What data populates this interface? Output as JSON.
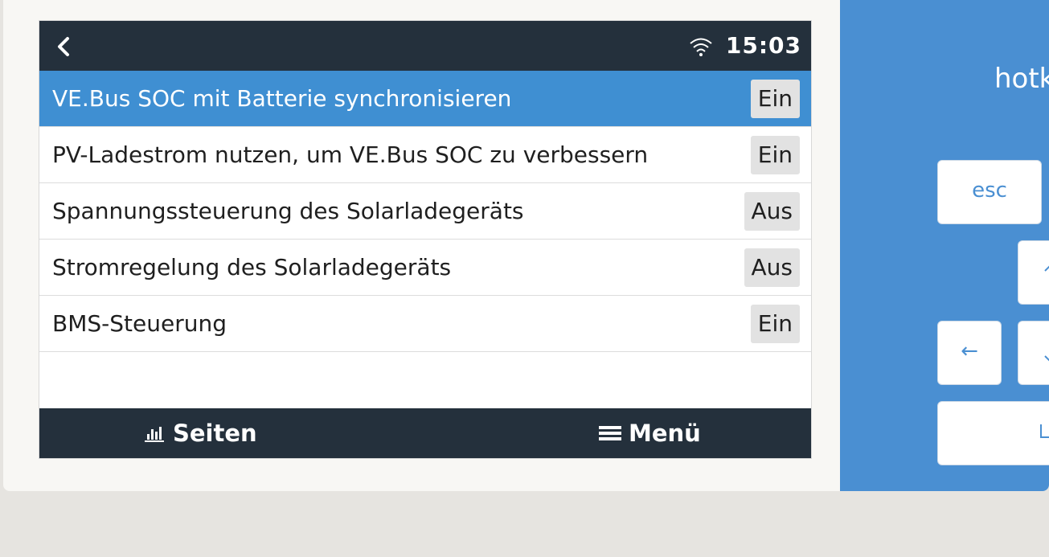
{
  "status": {
    "time": "15:03"
  },
  "settings": [
    {
      "label": "VE.Bus SOC mit Batterie synchronisieren",
      "value": "Ein",
      "selected": true
    },
    {
      "label": "PV-Ladestrom nutzen, um VE.Bus SOC zu verbessern",
      "value": "Ein",
      "selected": false
    },
    {
      "label": "Spannungssteuerung des Solarladegeräts",
      "value": "Aus",
      "selected": false
    },
    {
      "label": "Stromregelung des Solarladegeräts",
      "value": "Aus",
      "selected": false
    },
    {
      "label": "BMS-Steuerung",
      "value": "Ein",
      "selected": false
    }
  ],
  "bottombar": {
    "pages_label": "Seiten",
    "menu_label": "Menü"
  },
  "side_panel": {
    "title_partial": "hotk",
    "esc_label": "esc",
    "left_arrow": "←"
  },
  "icons": {
    "back": "chevron-left-icon",
    "wifi": "wifi-icon",
    "pages": "bar-chart-icon",
    "menu": "hamburger-icon"
  },
  "colors": {
    "topbar": "#24303c",
    "selected_row": "#3f8fd2",
    "side_panel": "#4a8fd2",
    "toggle_bg": "#e2e2e2"
  }
}
